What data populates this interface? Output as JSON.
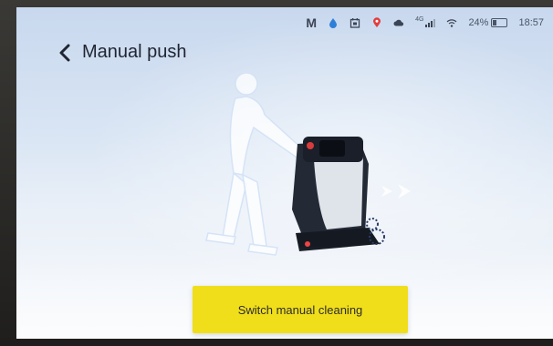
{
  "status_bar": {
    "icons": [
      "mail-m-icon",
      "water-drop-icon",
      "calendar-icon",
      "location-pin-icon",
      "cloud-icon",
      "signal-icon",
      "wifi-icon",
      "battery-icon"
    ],
    "signal_label": "4G",
    "battery_percent": "24%",
    "time": "18:57"
  },
  "header": {
    "title": "Manual push",
    "back_icon": "chevron-left-icon"
  },
  "illustration": {
    "description_icon": "person-pushing-robot-icon",
    "arrows_icon": "direction-arrows-icon"
  },
  "action": {
    "label": "Switch manual cleaning"
  },
  "colors": {
    "cta": "#f0de1a",
    "screen_top": "#c8d8ee",
    "screen_bottom": "#f4f7fb",
    "text": "#1f2532"
  }
}
